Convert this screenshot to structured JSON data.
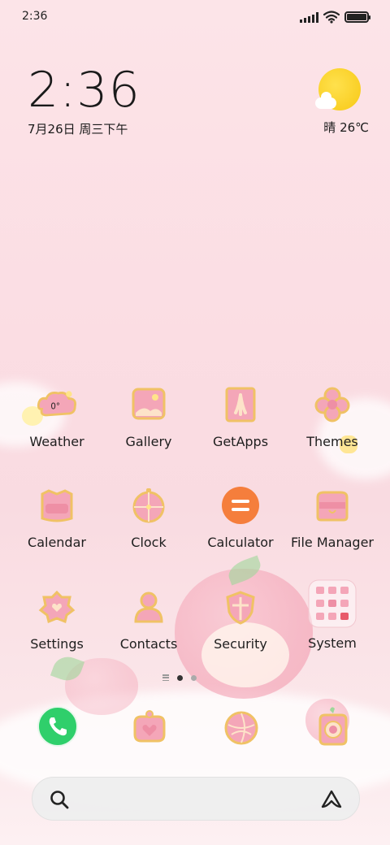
{
  "status_bar": {
    "time": "2:36"
  },
  "clock": {
    "time": "2:36",
    "date": "7月26日 周三下午"
  },
  "weather": {
    "text": "晴 26℃",
    "icon": "sunny-cloud-icon"
  },
  "apps": [
    {
      "label": "Weather",
      "badge": "0°"
    },
    {
      "label": "Gallery"
    },
    {
      "label": "GetApps"
    },
    {
      "label": "Themes"
    },
    {
      "label": "Calendar"
    },
    {
      "label": "Clock"
    },
    {
      "label": "Calculator"
    },
    {
      "label": "File Manager"
    },
    {
      "label": "Settings"
    },
    {
      "label": "Contacts"
    },
    {
      "label": "Security"
    },
    {
      "label": "System"
    }
  ],
  "dock": [
    "phone-icon",
    "messages-icon",
    "browser-icon",
    "camera-icon"
  ],
  "page_indicator": {
    "pages": 2,
    "current": 1
  },
  "colors": {
    "accent_pink": "#f4a6b8",
    "gold_outline": "#f0c265",
    "phone_green": "#2fcf6b",
    "calculator_orange": "#f57e3c"
  }
}
